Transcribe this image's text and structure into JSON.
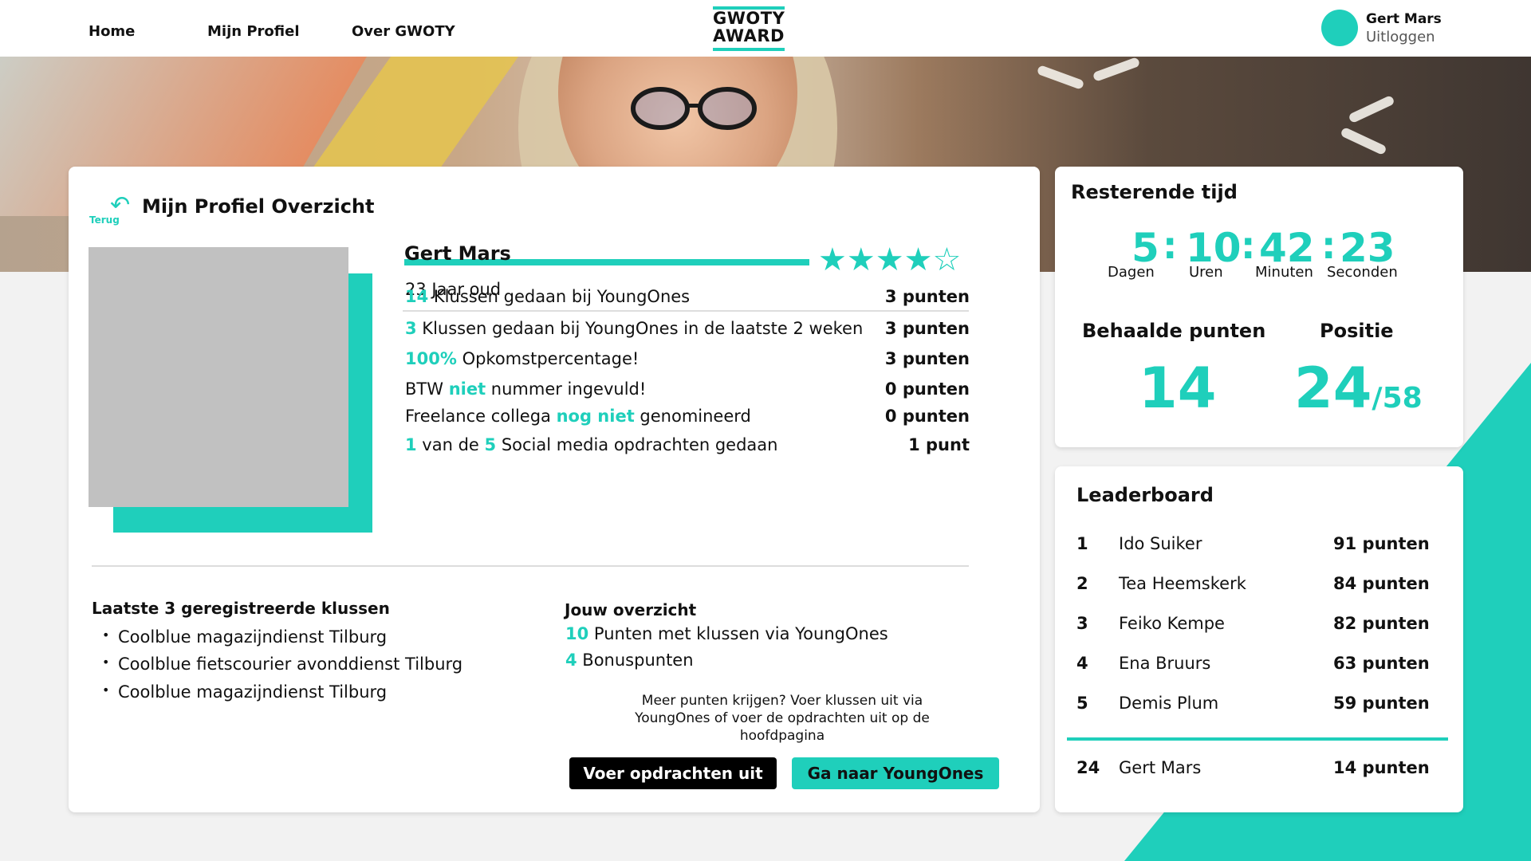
{
  "colors": {
    "accent": "#1fcfbb",
    "text": "#111111",
    "photo_placeholder": "#c1c1c1"
  },
  "nav": {
    "home": "Home",
    "profile": "Mijn Profiel",
    "about": "Over GWOTY"
  },
  "logo": {
    "line1": "GWOTY",
    "line2": "AWARD"
  },
  "user": {
    "name": "Gert Mars",
    "logout": "Uitloggen"
  },
  "main": {
    "back_label": "Terug",
    "back_icon": "undo-arrow-icon",
    "title": "Mijn Profiel Overzicht",
    "profile": {
      "name": "Gert Mars",
      "age": "23 Jaar oud",
      "rating": 4,
      "rating_max": 5,
      "stars": "★★★★☆"
    },
    "stats": [
      {
        "parts": [
          {
            "t": "14",
            "hl": true
          },
          {
            "t": " Klussen gedaan bij YoungOnes",
            "hl": false
          }
        ],
        "points": "3 punten"
      },
      {
        "parts": [
          {
            "t": "3",
            "hl": true
          },
          {
            "t": " Klussen gedaan bij YoungOnes in de laatste 2 weken",
            "hl": false
          }
        ],
        "points": "3 punten"
      },
      {
        "parts": [
          {
            "t": "100%",
            "hl": true
          },
          {
            "t": " Opkomstpercentage!",
            "hl": false
          }
        ],
        "points": "3 punten"
      },
      {
        "parts": [
          {
            "t": "BTW ",
            "hl": false
          },
          {
            "t": "niet",
            "hl": true
          },
          {
            "t": " nummer ingevuld!",
            "hl": false
          }
        ],
        "points": "0 punten"
      },
      {
        "parts": [
          {
            "t": "Freelance collega ",
            "hl": false
          },
          {
            "t": "nog niet",
            "hl": true
          },
          {
            "t": " genomineerd",
            "hl": false
          }
        ],
        "points": "0 punten"
      },
      {
        "parts": [
          {
            "t": "1",
            "hl": true
          },
          {
            "t": " van de ",
            "hl": false
          },
          {
            "t": "5",
            "hl": true
          },
          {
            "t": " Social media opdrachten gedaan",
            "hl": false
          }
        ],
        "points": "1 punt"
      }
    ],
    "jobs_title": "Laatste 3 geregistreerde klussen",
    "jobs": [
      "Coolblue magazijndienst Tilburg",
      "Coolblue fietscourier avonddienst Tilburg",
      "Coolblue magazijndienst Tilburg"
    ],
    "overview_title": "Jouw overzicht",
    "overview": [
      {
        "num": "10",
        "text": " Punten met klussen via YoungOnes"
      },
      {
        "num": "4",
        "text": " Bonuspunten"
      }
    ],
    "hint": "Meer punten krijgen? Voer klussen uit via YoungOnes of voer de opdrachten uit op de hoofdpagina",
    "btn_tasks": "Voer opdrachten uit",
    "btn_youngones": "Ga naar YoungOnes"
  },
  "timer": {
    "title": "Resterende tijd",
    "days": "5",
    "hours": "10",
    "minutes": "42",
    "seconds": "23",
    "sep": ":",
    "days_label": "Dagen",
    "hours_label": "Uren",
    "minutes_label": "Minuten",
    "seconds_label": "Seconden",
    "points_label": "Behaalde punten",
    "points": "14",
    "position_label": "Positie",
    "position": "24",
    "position_total": "/58"
  },
  "leaderboard": {
    "title": "Leaderboard",
    "rows": [
      {
        "rank": "1",
        "name": "Ido Suiker",
        "points": "91 punten"
      },
      {
        "rank": "2",
        "name": "Tea Heemskerk",
        "points": "84 punten"
      },
      {
        "rank": "3",
        "name": "Feiko Kempe",
        "points": "82 punten"
      },
      {
        "rank": "4",
        "name": "Ena Bruurs",
        "points": "63 punten"
      },
      {
        "rank": "5",
        "name": "Demis Plum",
        "points": "59 punten"
      }
    ],
    "me": {
      "rank": "24",
      "name": "Gert Mars",
      "points": "14 punten"
    }
  }
}
